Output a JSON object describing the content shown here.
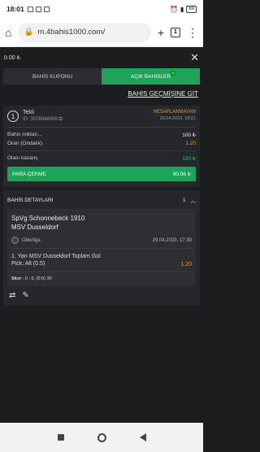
{
  "status_bar": {
    "time": "18:01",
    "battery": "69"
  },
  "browser": {
    "url": "m.4bahis1000.com/",
    "tab_count": "1"
  },
  "balance": "0.00 ₺",
  "tabs": [
    {
      "label": "BAHİS KUPONU"
    },
    {
      "label": "AÇIK BAHİSLER"
    }
  ],
  "history_link": "BAHİS GEÇMİŞİNE GİT",
  "bet": {
    "count": "1",
    "type": "Tekli",
    "id_label": "ID: 3076948008",
    "status": "HESAPLANMAYAN",
    "datetime": "29.04.2023, 18:01",
    "stake_label": "Bahis miktarı...",
    "stake_value": "100 ₺",
    "odds_label": "Oran (Ondalık)",
    "odds_value": "1.20",
    "potential_label": "Olası kazanç",
    "potential_value": "120 ₺",
    "cashout_label": "PARA ÇEKME",
    "cashout_value": "90.56 ₺"
  },
  "details": {
    "title": "BAHİS DETAYLARI",
    "count": "1",
    "home": "SpVg Schonnebeck 1910",
    "away": "MSV Dusseldorf",
    "league": "Oberliga",
    "match_date": "29.04.2023, 17:30",
    "market": "1. Yarı MSV Dusseldorf Toplam Gol",
    "pick": "Pick: Alt (0.5)",
    "odds": "1.20",
    "score_label": "Skor",
    "score_value": ": 0 : 0, (0:0) 30`"
  },
  "colors": {
    "accent": "#1fa35a",
    "warning": "#e0a020",
    "background": "#1c1d1f"
  }
}
